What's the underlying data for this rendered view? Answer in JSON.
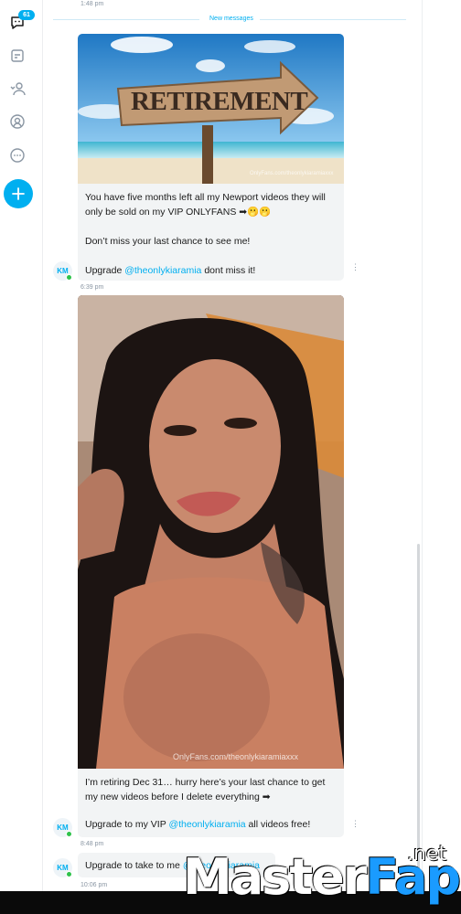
{
  "sidebar": {
    "badge_count": "61",
    "icons": [
      "chat-icon",
      "bookmark-icon",
      "people-icon",
      "profile-icon",
      "more-icon"
    ],
    "new_button": "+"
  },
  "timestamps": {
    "top": "1:48 pm",
    "msg1": "6:39 pm",
    "msg2": "8:48 pm",
    "msg3": "10:06 pm"
  },
  "divider_label": "New messages",
  "messages": [
    {
      "image_sign": "RETIREMENT",
      "image_watermark": "OnlyFans.com/theonlykiaramiaxxx",
      "line1": "You have five months left all my Newport videos they will only be sold on my VIP ONLYFANS ➡🫢🫢",
      "line2": "Don’t miss your last chance to see me!",
      "line3_prefix": "Upgrade ",
      "line3_link": "@theonlykiaramia",
      "line3_suffix": " dont miss it!"
    },
    {
      "image_watermark": "OnlyFans.com/theonlykiaramiaxxx",
      "line1": "I’m retiring Dec 31… hurry here’s your last chance to get my new videos before I delete everything ➡",
      "line2_prefix": "Upgrade to my VIP ",
      "line2_link": "@theonlykiaramia",
      "line2_suffix": " all videos free!"
    },
    {
      "line1_prefix": "Upgrade to take to me ",
      "line1_link": "@theonlykiaramia"
    }
  ],
  "avatar_initials": "KM",
  "kebab": "⋮",
  "site_logo": {
    "part1": "Master",
    "part2": "Fap",
    "suffix": ".net"
  },
  "colors": {
    "accent": "#00aff0",
    "bubble": "#f2f4f5",
    "online": "#2ec24b"
  }
}
